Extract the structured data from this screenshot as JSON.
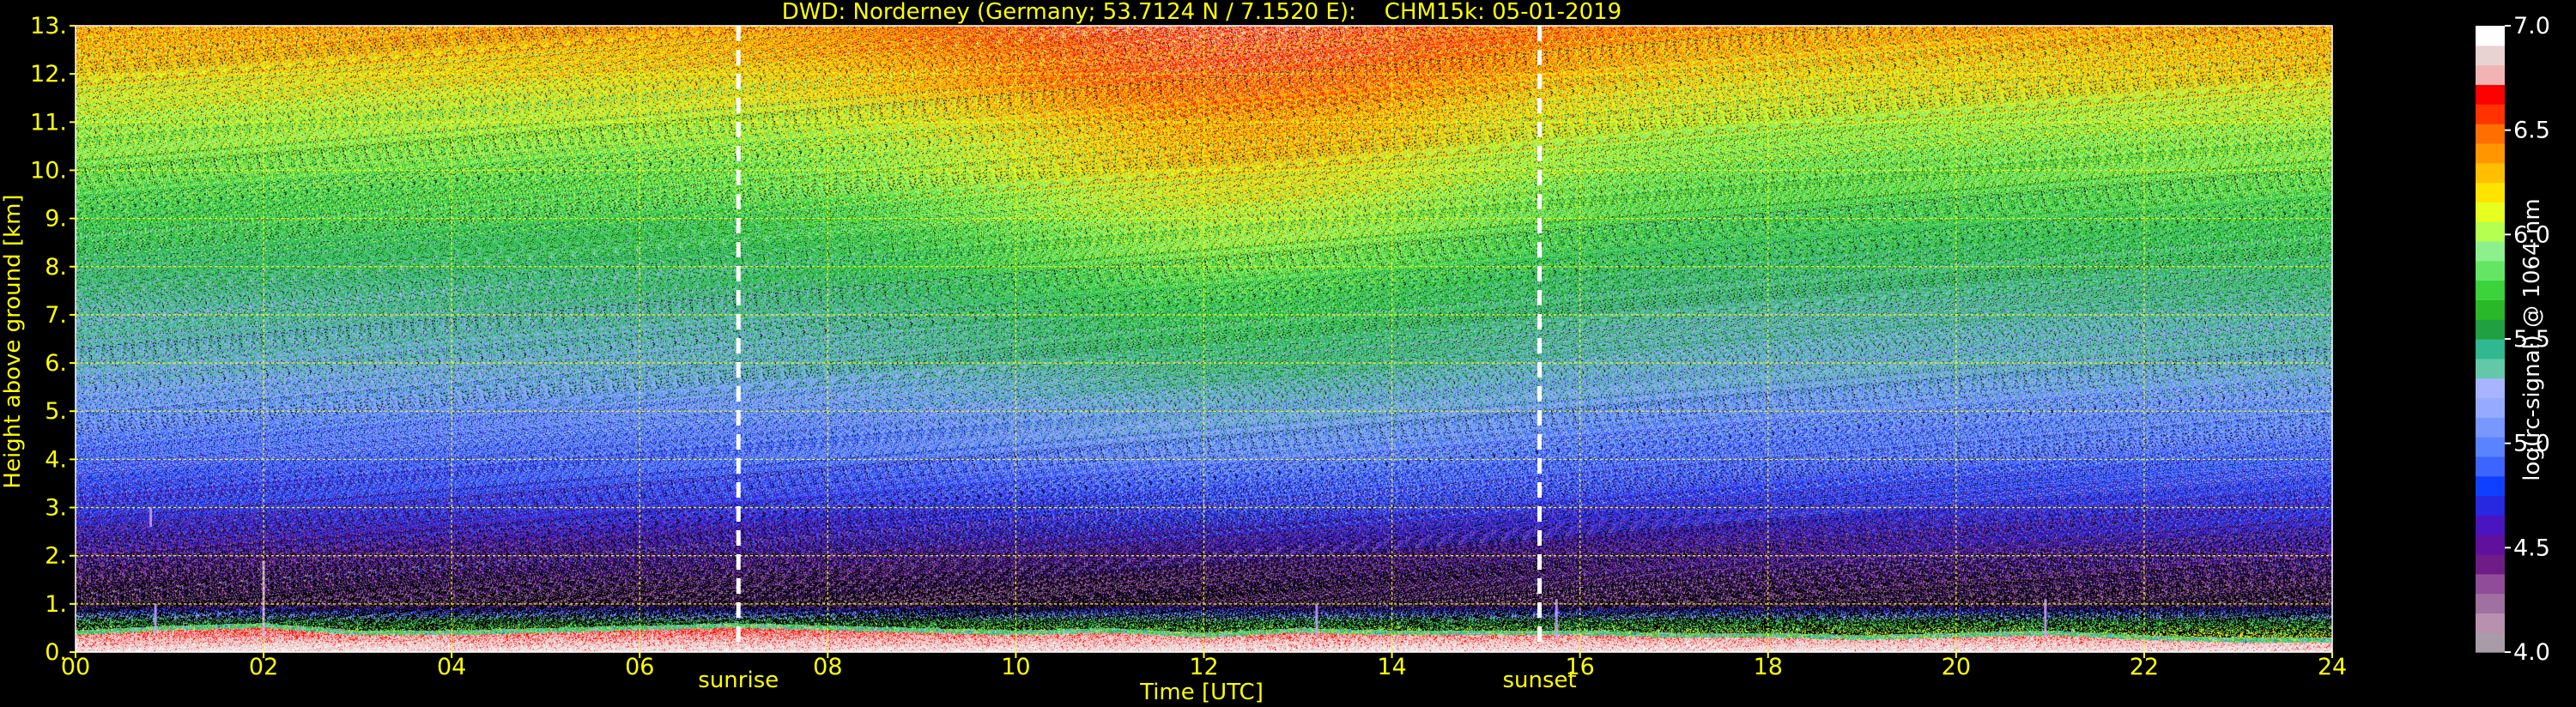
{
  "chart_data": {
    "type": "heatmap",
    "title": "DWD: Norderney (Germany; 53.7124 N / 7.1520 E):    CHM15k: 05-01-2019",
    "xlabel": "Time [UTC]",
    "ylabel": "Height above ground [km]",
    "xlim": [
      0,
      24
    ],
    "ylim": [
      0,
      13
    ],
    "xticks": [
      0,
      2,
      4,
      6,
      8,
      10,
      12,
      14,
      16,
      18,
      20,
      22,
      24
    ],
    "xtick_labels": [
      "00",
      "02",
      "04",
      "06",
      "08",
      "10",
      "12",
      "14",
      "16",
      "18",
      "20",
      "22",
      "24"
    ],
    "yticks": [
      0,
      1,
      2,
      3,
      4,
      5,
      6,
      7,
      8,
      9,
      10,
      11,
      12,
      13
    ],
    "ytick_labels": [
      "0.",
      "1.",
      "2.",
      "3.",
      "4.",
      "5.",
      "6.",
      "7.",
      "8.",
      "9.",
      "10.",
      "11.",
      "12.",
      "13."
    ],
    "grid": true,
    "grid_color": "#ffff00",
    "text_color": "#ffff00",
    "background": "#000000",
    "markers": [
      {
        "name": "sunrise",
        "x": 7.05
      },
      {
        "name": "sunset",
        "x": 15.57
      }
    ],
    "colorbar": {
      "label": "log(rc-signal) @ 1064 nm",
      "range": [
        4.0,
        7.0
      ],
      "ticks": [
        4.0,
        4.5,
        5.0,
        5.5,
        6.0,
        6.5,
        7.0
      ],
      "tick_labels": [
        "4.0",
        "4.5",
        "5.0",
        "5.5",
        "6.0",
        "6.5",
        "7.0"
      ],
      "colors": [
        "#a89ca8",
        "#b890b0",
        "#a070a0",
        "#904c98",
        "#6e1c88",
        "#60109c",
        "#4a14c0",
        "#2828e0",
        "#1040ff",
        "#3c64ff",
        "#5a84ff",
        "#7898ff",
        "#96aaff",
        "#a8b4ff",
        "#62c8a8",
        "#30b890",
        "#20a040",
        "#28b828",
        "#3cd23c",
        "#64e664",
        "#8cf08c",
        "#b4ff50",
        "#e6ff1e",
        "#ffe400",
        "#ffbe00",
        "#ff9600",
        "#ff6e00",
        "#ff3200",
        "#ff0000",
        "#f0b4b4",
        "#e8d2d2",
        "#ffffff"
      ]
    },
    "signal_profile": {
      "height_km": [
        0,
        0.6,
        1,
        2,
        3,
        4,
        5,
        6,
        7,
        8,
        9,
        10,
        11,
        12,
        13
      ],
      "log_signal": [
        6.6,
        5.7,
        4.3,
        4.5,
        4.75,
        4.95,
        5.1,
        5.3,
        5.4,
        5.55,
        5.7,
        5.85,
        6.0,
        6.2,
        6.35
      ]
    },
    "boundary_layer_top_km": [
      [
        0,
        0.45
      ],
      [
        1,
        0.55
      ],
      [
        2,
        0.6
      ],
      [
        3,
        0.45
      ],
      [
        4,
        0.45
      ],
      [
        5,
        0.5
      ],
      [
        6,
        0.55
      ],
      [
        7,
        0.6
      ],
      [
        8,
        0.55
      ],
      [
        9,
        0.5
      ],
      [
        10,
        0.45
      ],
      [
        11,
        0.5
      ],
      [
        12,
        0.4
      ],
      [
        13,
        0.5
      ],
      [
        14,
        0.45
      ],
      [
        15,
        0.45
      ],
      [
        16,
        0.45
      ],
      [
        17,
        0.4
      ],
      [
        18,
        0.4
      ],
      [
        19,
        0.35
      ],
      [
        20,
        0.4
      ],
      [
        21,
        0.45
      ],
      [
        22,
        0.35
      ],
      [
        23,
        0.3
      ],
      [
        24,
        0.3
      ]
    ],
    "features": [
      {
        "x": 0.85,
        "y0": 0.4,
        "y1": 1.0
      },
      {
        "x": 2.0,
        "y0": 0.3,
        "y1": 1.9
      },
      {
        "x": 0.8,
        "y0": 2.6,
        "y1": 3.0
      },
      {
        "x": 13.2,
        "y0": 0.3,
        "y1": 1.0
      },
      {
        "x": 15.75,
        "y0": 0.3,
        "y1": 1.1
      },
      {
        "x": 20.95,
        "y0": 0.3,
        "y1": 1.1
      }
    ]
  }
}
